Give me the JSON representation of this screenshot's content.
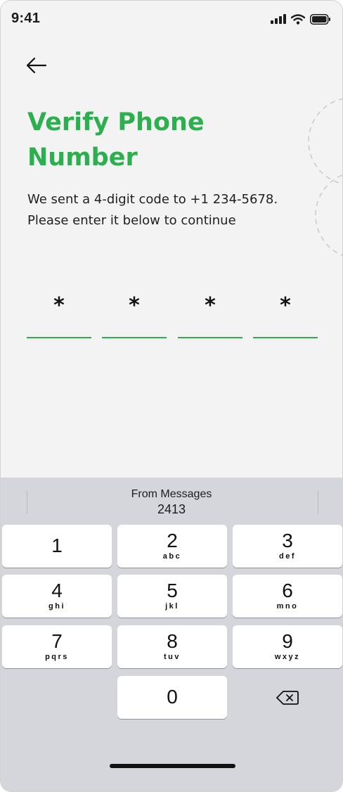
{
  "status_bar": {
    "time": "9:41",
    "icons": [
      "cellular-signal-icon",
      "wifi-icon",
      "battery-icon"
    ]
  },
  "header": {
    "back_icon": "arrow-left-icon"
  },
  "content": {
    "title": "Verify Phone Number",
    "subtitle_line1": "We sent a 4-digit code to +1 234-5678.",
    "subtitle_line2": "Please enter it below to continue"
  },
  "otp": {
    "digits": [
      "*",
      "*",
      "*",
      "*"
    ]
  },
  "keyboard": {
    "suggestion": {
      "label": "From Messages",
      "code": "2413"
    },
    "keys": [
      {
        "digit": "1",
        "letters": ""
      },
      {
        "digit": "2",
        "letters": "abc"
      },
      {
        "digit": "3",
        "letters": "def"
      },
      {
        "digit": "4",
        "letters": "ghi"
      },
      {
        "digit": "5",
        "letters": "jkl"
      },
      {
        "digit": "6",
        "letters": "mno"
      },
      {
        "digit": "7",
        "letters": "pqrs"
      },
      {
        "digit": "8",
        "letters": "tuv"
      },
      {
        "digit": "9",
        "letters": "wxyz"
      },
      {
        "digit": "0",
        "letters": ""
      }
    ],
    "delete_icon": "backspace-icon"
  },
  "colors": {
    "accent": "#2eaf4f",
    "background": "#f3f3f3",
    "keyboard_background": "#d4d6dc",
    "key_background": "#ffffff"
  }
}
